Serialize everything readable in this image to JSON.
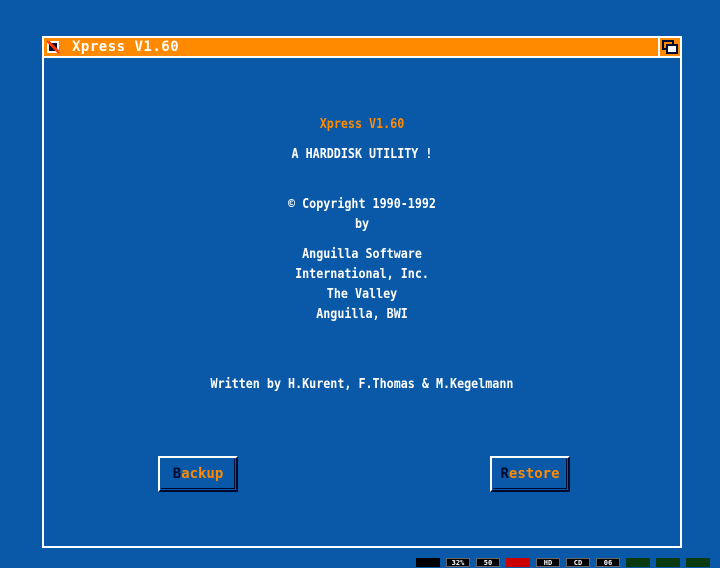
{
  "window": {
    "title": "Xpress V1.60"
  },
  "about": {
    "app_name": "Xpress V1.60",
    "tagline": "A HARDDISK UTILITY !",
    "copyright": "© Copyright 1990-1992",
    "by": "by",
    "company_line1": "Anguilla Software",
    "company_line2": "International, Inc.",
    "company_line3": "The Valley",
    "company_line4": "Anguilla, BWI",
    "authors": "Written by H.Kurent, F.Thomas & M.Kegelmann"
  },
  "buttons": {
    "backup": {
      "hotkey": "B",
      "rest": "ackup"
    },
    "restore": {
      "hotkey": "R",
      "rest": "estore"
    }
  },
  "status_leds": {
    "power": "",
    "cpu": "32%",
    "fps": "50",
    "hd": "HD",
    "cd": "CD",
    "df0": "06"
  },
  "colors": {
    "background": "#0a58a8",
    "accent": "#ff8a00",
    "text": "#ffffff",
    "shadow": "#000a30"
  }
}
